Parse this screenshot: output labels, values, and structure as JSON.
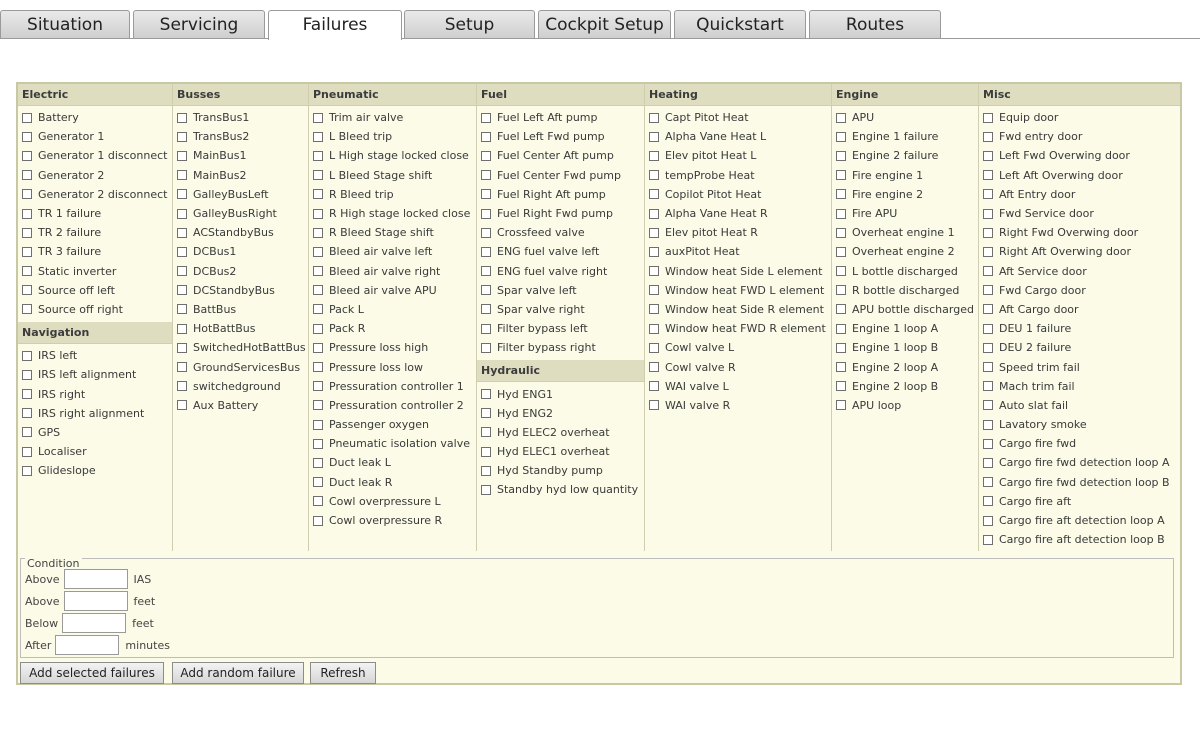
{
  "tabs": [
    "Situation",
    "Servicing",
    "Failures",
    "Setup",
    "Cockpit Setup",
    "Quickstart",
    "Routes"
  ],
  "active_tab": "Failures",
  "columns": [
    {
      "sections": [
        {
          "title": "Electric",
          "items": [
            "Battery",
            "Generator 1",
            "Generator 1 disconnect",
            "Generator 2",
            "Generator 2 disconnect",
            "TR 1 failure",
            "TR 2 failure",
            "TR 3 failure",
            "Static inverter",
            "Source off left",
            "Source off right"
          ]
        },
        {
          "title": "Navigation",
          "items": [
            "IRS left",
            "IRS left alignment",
            "IRS right",
            "IRS right alignment",
            "GPS",
            "Localiser",
            "Glideslope"
          ]
        }
      ]
    },
    {
      "sections": [
        {
          "title": "Busses",
          "items": [
            "TransBus1",
            "TransBus2",
            "MainBus1",
            "MainBus2",
            "GalleyBusLeft",
            "GalleyBusRight",
            "ACStandbyBus",
            "DCBus1",
            "DCBus2",
            "DCStandbyBus",
            "BattBus",
            "HotBattBus",
            "SwitchedHotBattBus",
            "GroundServicesBus",
            "switchedground",
            "Aux Battery"
          ]
        }
      ]
    },
    {
      "sections": [
        {
          "title": "Pneumatic",
          "items": [
            "Trim air valve",
            "L Bleed trip",
            "L High stage locked close",
            "L Bleed Stage shift",
            "R Bleed trip",
            "R High stage locked close",
            "R Bleed Stage shift",
            "Bleed air valve left",
            "Bleed air valve right",
            "Bleed air valve APU",
            "Pack L",
            "Pack R",
            "Pressure loss high",
            "Pressure loss low",
            "Pressuration controller 1",
            "Pressuration controller 2",
            "Passenger oxygen",
            "Pneumatic isolation valve",
            "Duct leak L",
            "Duct leak R",
            "Cowl overpressure L",
            "Cowl overpressure R"
          ]
        }
      ]
    },
    {
      "sections": [
        {
          "title": "Fuel",
          "items": [
            "Fuel Left Aft pump",
            "Fuel Left Fwd pump",
            "Fuel Center Aft pump",
            "Fuel Center Fwd pump",
            "Fuel Right Aft pump",
            "Fuel Right Fwd pump",
            "Crossfeed valve",
            "ENG fuel valve left",
            "ENG fuel valve right",
            "Spar valve left",
            "Spar valve right",
            "Filter bypass left",
            "Filter bypass right"
          ]
        },
        {
          "title": "Hydraulic",
          "items": [
            "Hyd ENG1",
            "Hyd ENG2",
            "Hyd ELEC2 overheat",
            "Hyd ELEC1 overheat",
            "Hyd Standby pump",
            "Standby hyd low quantity"
          ]
        }
      ]
    },
    {
      "sections": [
        {
          "title": "Heating",
          "items": [
            "Capt Pitot Heat",
            "Alpha Vane Heat L",
            "Elev pitot Heat L",
            "tempProbe Heat",
            "Copilot Pitot Heat",
            "Alpha Vane Heat R",
            "Elev pitot Heat R",
            "auxPitot Heat",
            "Window heat Side L element",
            "Window heat FWD L element",
            "Window heat Side R element",
            "Window heat FWD R element",
            "Cowl valve L",
            "Cowl valve R",
            "WAI valve L",
            "WAI valve R"
          ]
        }
      ]
    },
    {
      "sections": [
        {
          "title": "Engine",
          "items": [
            "APU",
            "Engine 1 failure",
            "Engine 2 failure",
            "Fire engine 1",
            "Fire engine 2",
            "Fire APU",
            "Overheat engine 1",
            "Overheat engine 2",
            "L bottle discharged",
            "R bottle discharged",
            "APU bottle discharged",
            "Engine 1 loop A",
            "Engine 1 loop B",
            "Engine 2 loop A",
            "Engine 2 loop B",
            "APU loop"
          ]
        }
      ]
    },
    {
      "sections": [
        {
          "title": "Misc",
          "items": [
            "Equip door",
            "Fwd entry door",
            "Left Fwd Overwing door",
            "Left Aft Overwing door",
            "Aft Entry door",
            "Fwd Service door",
            "Right Fwd Overwing door",
            "Right Aft Overwing door",
            "Aft Service door",
            "Fwd Cargo door",
            "Aft Cargo door",
            "DEU 1 failure",
            "DEU 2 failure",
            "Speed trim fail",
            "Mach trim fail",
            "Auto slat fail",
            "Lavatory smoke",
            "Cargo fire fwd",
            "Cargo fire fwd detection loop A",
            "Cargo fire fwd detection loop B",
            "Cargo fire aft",
            "Cargo fire aft detection loop A",
            "Cargo fire aft detection loop B"
          ]
        }
      ]
    }
  ],
  "condition": {
    "legend": "Condition",
    "rows": [
      {
        "label": "Above",
        "value": "",
        "unit": "IAS"
      },
      {
        "label": "Above",
        "value": "",
        "unit": "feet"
      },
      {
        "label": "Below",
        "value": "",
        "unit": "feet"
      },
      {
        "label": "After",
        "value": "",
        "unit": "minutes"
      }
    ]
  },
  "buttons": {
    "add_selected": "Add selected failures",
    "add_random": "Add random failure",
    "refresh": "Refresh"
  },
  "colors": {
    "panel_bg": "#fbfbe8",
    "header_bg": "#deddc0",
    "border": "#c8c8a4"
  }
}
